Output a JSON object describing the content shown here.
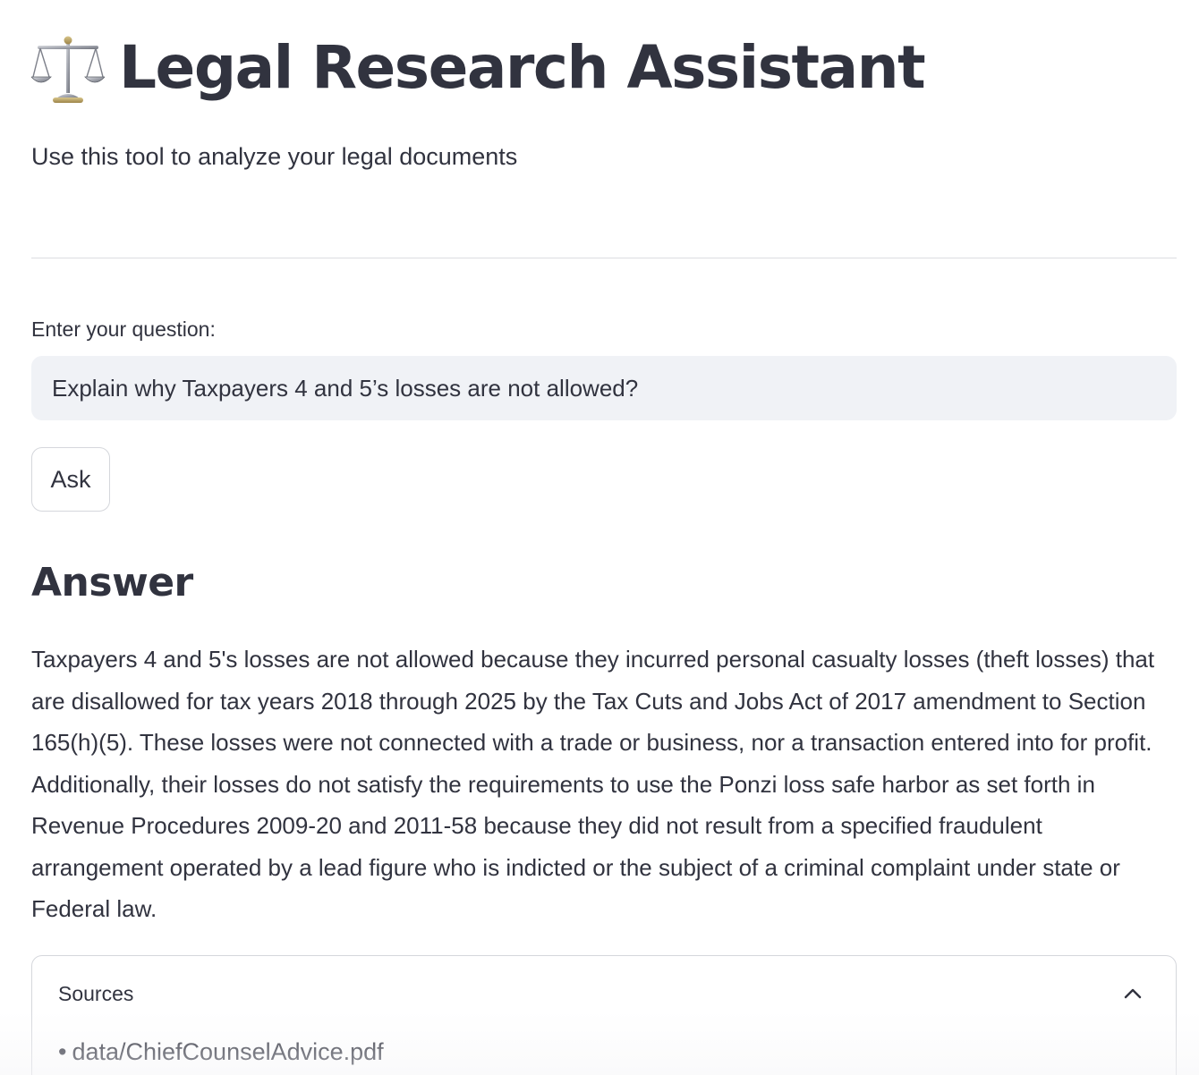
{
  "header": {
    "icon": "balance-scale-icon",
    "title": "Legal Research Assistant",
    "subtitle": "Use this tool to analyze your legal documents"
  },
  "question": {
    "label": "Enter your question:",
    "value": "Explain why Taxpayers 4 and 5’s losses are not allowed?"
  },
  "ask_button": {
    "label": "Ask"
  },
  "answer": {
    "heading": "Answer",
    "text": "Taxpayers 4 and 5's losses are not allowed because they incurred personal casualty losses (theft losses) that are disallowed for tax years 2018 through 2025 by the Tax Cuts and Jobs Act of 2017 amendment to Section 165(h)(5). These losses were not connected with a trade or business, nor a transaction entered into for profit. Additionally, their losses do not satisfy the requirements to use the Ponzi loss safe harbor as set forth in Revenue Procedures 2009-20 and 2011-58 because they did not result from a specified fraudulent arrangement operated by a lead figure who is indicted or the subject of a criminal complaint under state or Federal law."
  },
  "sources": {
    "label": "Sources",
    "expanded": true,
    "items": [
      {
        "bullet": "•",
        "path": "data/ChiefCounselAdvice.pdf"
      }
    ]
  },
  "colors": {
    "text": "#31333f",
    "input_background": "#f0f2f6",
    "border": "#d5d7dc",
    "divider": "#dcdde1",
    "scales_gold": "#b8b8c0"
  }
}
